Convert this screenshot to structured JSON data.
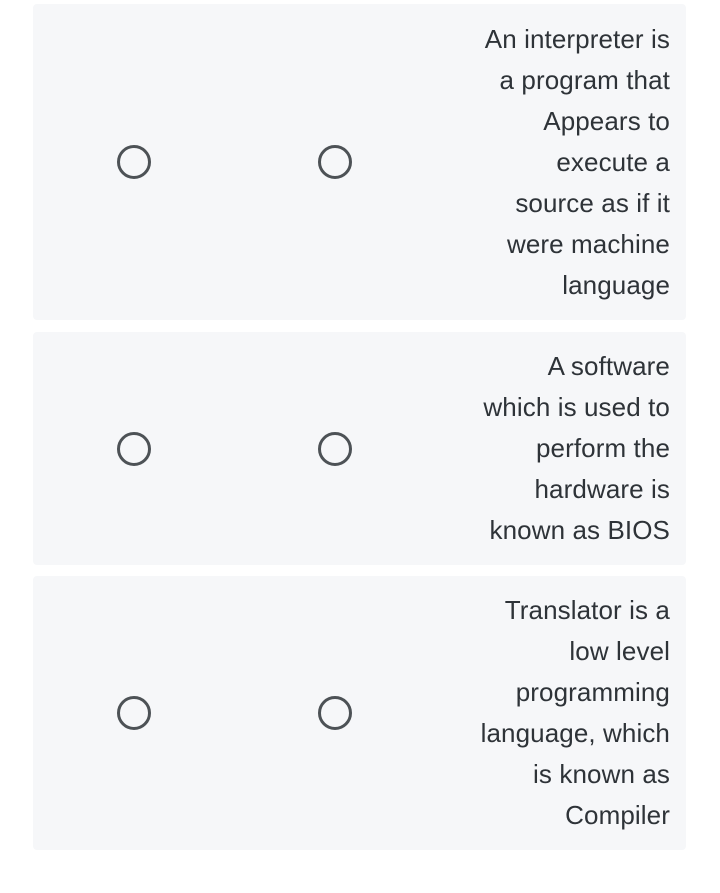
{
  "theme": {
    "page_background": "#ffffff",
    "card_background": "#f6f7f9",
    "text_color": "#2e3338",
    "radio_stroke_color": "#4d5256"
  },
  "options": [
    {
      "id": "option-1",
      "statement": "An interpreter is\na program that\nAppears to\nexecute a\nsource as if it\nwere machine\nlanguage",
      "choices": [
        {
          "id": "option-1-choice-a",
          "selected": false
        },
        {
          "id": "option-1-choice-b",
          "selected": false
        }
      ]
    },
    {
      "id": "option-2",
      "statement": "A software\nwhich is used to\nperform the\nhardware is\nknown as BIOS",
      "choices": [
        {
          "id": "option-2-choice-a",
          "selected": false
        },
        {
          "id": "option-2-choice-b",
          "selected": false
        }
      ]
    },
    {
      "id": "option-3",
      "statement": "Translator is a\nlow level\nprogramming\nlanguage, which\nis known as\nCompiler",
      "choices": [
        {
          "id": "option-3-choice-a",
          "selected": false
        },
        {
          "id": "option-3-choice-b",
          "selected": false
        }
      ]
    }
  ]
}
